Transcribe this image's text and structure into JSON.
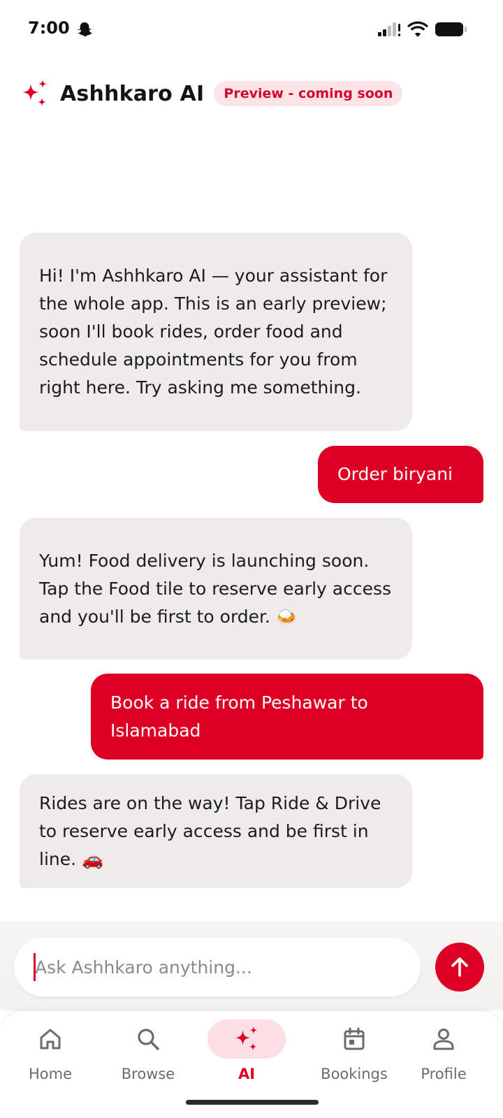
{
  "status_bar": {
    "time": "7:00",
    "icons": [
      "snapchat-icon",
      "signal-icon",
      "wifi-icon",
      "battery-icon"
    ]
  },
  "header": {
    "title": "Ashhkaro AI",
    "badge": "Preview - coming soon",
    "icon": "sparkle-icon"
  },
  "messages": [
    {
      "role": "bot",
      "text": "Hi! I'm Ashhkaro AI — your assistant for the whole app. This is an early preview; soon I'll book rides, order food and schedule appointments for you from right here. Try asking me something."
    },
    {
      "role": "user",
      "text": "Order biryani"
    },
    {
      "role": "bot",
      "text": "Yum! Food delivery is launching soon. Tap the Food tile to reserve early access and you'll be first to order. 🍛"
    },
    {
      "role": "user",
      "text": "Book a ride from Peshawar to Islamabad"
    },
    {
      "role": "bot",
      "text": "Rides are on the way! Tap Ride & Drive to reserve early access and be first in line. 🚗"
    }
  ],
  "composer": {
    "placeholder": "Ask Ashhkaro anything...",
    "value": "",
    "send_icon": "arrow-up-icon"
  },
  "nav": {
    "items": [
      {
        "label": "Home",
        "icon": "home-icon",
        "active": false
      },
      {
        "label": "Browse",
        "icon": "search-icon",
        "active": false
      },
      {
        "label": "AI",
        "icon": "sparkle-icon",
        "active": true
      },
      {
        "label": "Bookings",
        "icon": "calendar-icon",
        "active": false
      },
      {
        "label": "Profile",
        "icon": "person-icon",
        "active": false
      }
    ]
  },
  "colors": {
    "accent": "#dd0024",
    "badge_bg": "#fce4e8",
    "bot_bubble": "#efebea",
    "active_pill": "#fbdfe4"
  }
}
